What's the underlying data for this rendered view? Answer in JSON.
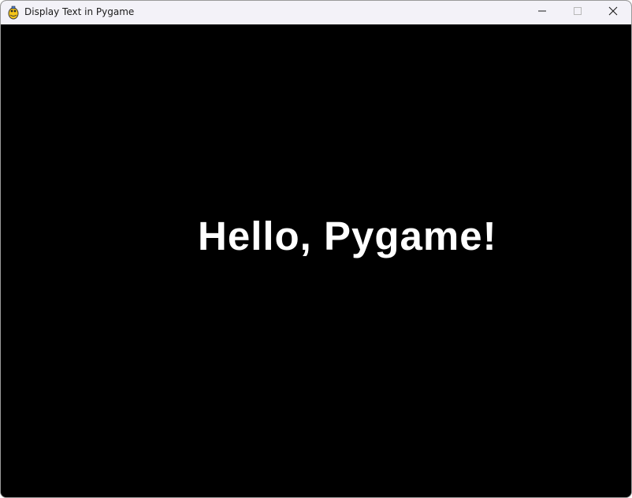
{
  "window": {
    "title": "Display Text in Pygame",
    "app_icon": "pygame-snake-icon",
    "controls": {
      "minimize_icon": "minimize-icon",
      "maximize_icon": "maximize-icon",
      "close_icon": "close-icon"
    }
  },
  "canvas": {
    "background_color": "#000000",
    "text": "Hello, Pygame!",
    "text_color": "#ffffff"
  }
}
